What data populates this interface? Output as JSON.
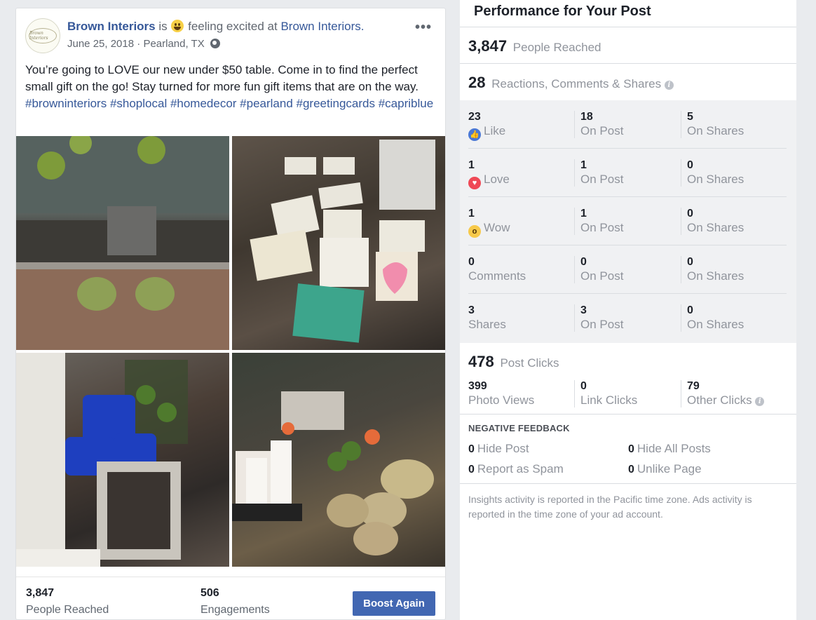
{
  "post": {
    "page_name": "Brown Interiors",
    "is_text": "is",
    "feeling_text": "feeling excited at",
    "location_page": "Brown Interiors.",
    "logo_text": "Brown Interiors",
    "date": "June 25, 2018",
    "place": "Pearland, TX",
    "more_label": "•••",
    "text": "You’re going to LOVE our new under $50 table. Come in to find the perfect small gift on the go! Stay turned for more fun gift items that are on the way.",
    "hashtags": "#browninteriors #shoplocal #homedecor #pearland #greetingcards #capriblue",
    "footer": {
      "reach_value": "3,847",
      "reach_label": "People Reached",
      "engagements_value": "506",
      "engagements_label": "Engagements",
      "boost_label": "Boost Again"
    }
  },
  "insights": {
    "title": "Performance for Your Post",
    "people_reached": {
      "value": "3,847",
      "label": "People Reached"
    },
    "reactions": {
      "value": "28",
      "label": "Reactions, Comments & Shares"
    },
    "rows": [
      {
        "total": "23",
        "label": "Like",
        "on_post": "18",
        "on_post_label": "On Post",
        "on_shares": "5",
        "on_shares_label": "On Shares"
      },
      {
        "total": "1",
        "label": "Love",
        "on_post": "1",
        "on_post_label": "On Post",
        "on_shares": "0",
        "on_shares_label": "On Shares"
      },
      {
        "total": "1",
        "label": "Wow",
        "on_post": "1",
        "on_post_label": "On Post",
        "on_shares": "0",
        "on_shares_label": "On Shares"
      },
      {
        "total": "0",
        "label": "Comments",
        "on_post": "0",
        "on_post_label": "On Post",
        "on_shares": "0",
        "on_shares_label": "On Shares"
      },
      {
        "total": "3",
        "label": "Shares",
        "on_post": "3",
        "on_post_label": "On Post",
        "on_shares": "0",
        "on_shares_label": "On Shares"
      }
    ],
    "post_clicks": {
      "value": "478",
      "label": "Post Clicks"
    },
    "clicks": [
      {
        "value": "399",
        "label": "Photo Views"
      },
      {
        "value": "0",
        "label": "Link Clicks"
      },
      {
        "value": "79",
        "label": "Other Clicks"
      }
    ],
    "negative_title": "NEGATIVE FEEDBACK",
    "negative": [
      {
        "value": "0",
        "label": "Hide Post"
      },
      {
        "value": "0",
        "label": "Hide All Posts"
      },
      {
        "value": "0",
        "label": "Report as Spam"
      },
      {
        "value": "0",
        "label": "Unlike Page"
      }
    ],
    "footnote": "Insights activity is reported in the Pacific time zone. Ads activity is reported in the time zone of your ad account."
  }
}
